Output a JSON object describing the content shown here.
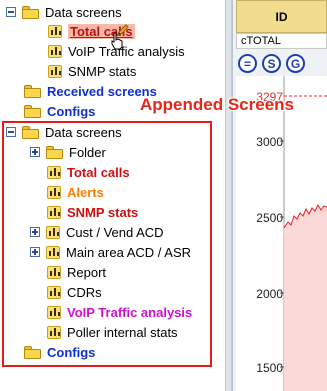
{
  "tree_top": [
    {
      "label": "Data screens",
      "icon": "folder-icon",
      "style": "normal",
      "expander": "minus"
    },
    {
      "label": "Total calls",
      "icon": "bar-chart-icon",
      "style": "selected"
    },
    {
      "label": "VoIP Traffic analysis",
      "icon": "bar-chart-icon",
      "style": "normal"
    },
    {
      "label": "SNMP stats",
      "icon": "bar-chart-icon",
      "style": "normal"
    },
    {
      "label": "Received screens",
      "icon": "folder-icon",
      "style": "blue"
    },
    {
      "label": "Configs",
      "icon": "folder-icon",
      "style": "blue"
    }
  ],
  "annotation": "Appended Screens",
  "appended": [
    {
      "label": "Data screens",
      "icon": "folder-icon",
      "style": "normal",
      "expander": "minus"
    },
    {
      "label": "Folder",
      "icon": "folder-icon",
      "style": "normal",
      "expander": "plus"
    },
    {
      "label": "Total calls",
      "icon": "bar-chart-icon",
      "style": "red"
    },
    {
      "label": "Alerts",
      "icon": "bar-chart-icon",
      "style": "orange"
    },
    {
      "label": "SNMP stats",
      "icon": "bar-chart-icon",
      "style": "red"
    },
    {
      "label": "Cust / Vend ACD",
      "icon": "bar-chart-icon",
      "style": "normal",
      "expander": "plus"
    },
    {
      "label": "Main area ACD / ASR",
      "icon": "bar-chart-icon",
      "style": "normal",
      "expander": "plus"
    },
    {
      "label": "Report",
      "icon": "bar-chart-icon",
      "style": "normal"
    },
    {
      "label": "CDRs",
      "icon": "bar-chart-icon",
      "style": "normal"
    },
    {
      "label": "VoIP Traffic analysis",
      "icon": "bar-chart-icon",
      "style": "magenta"
    },
    {
      "label": "Poller internal stats",
      "icon": "bar-chart-icon",
      "style": "normal"
    },
    {
      "label": "Configs",
      "icon": "folder-icon",
      "style": "blue"
    }
  ],
  "right": {
    "id_header": "ID",
    "ctotal": "cTOTAL",
    "toolbar_buttons": [
      "=",
      "S",
      "G"
    ],
    "y_labels": [
      "3297",
      "3000",
      "2500",
      "2000",
      "1500"
    ]
  }
}
